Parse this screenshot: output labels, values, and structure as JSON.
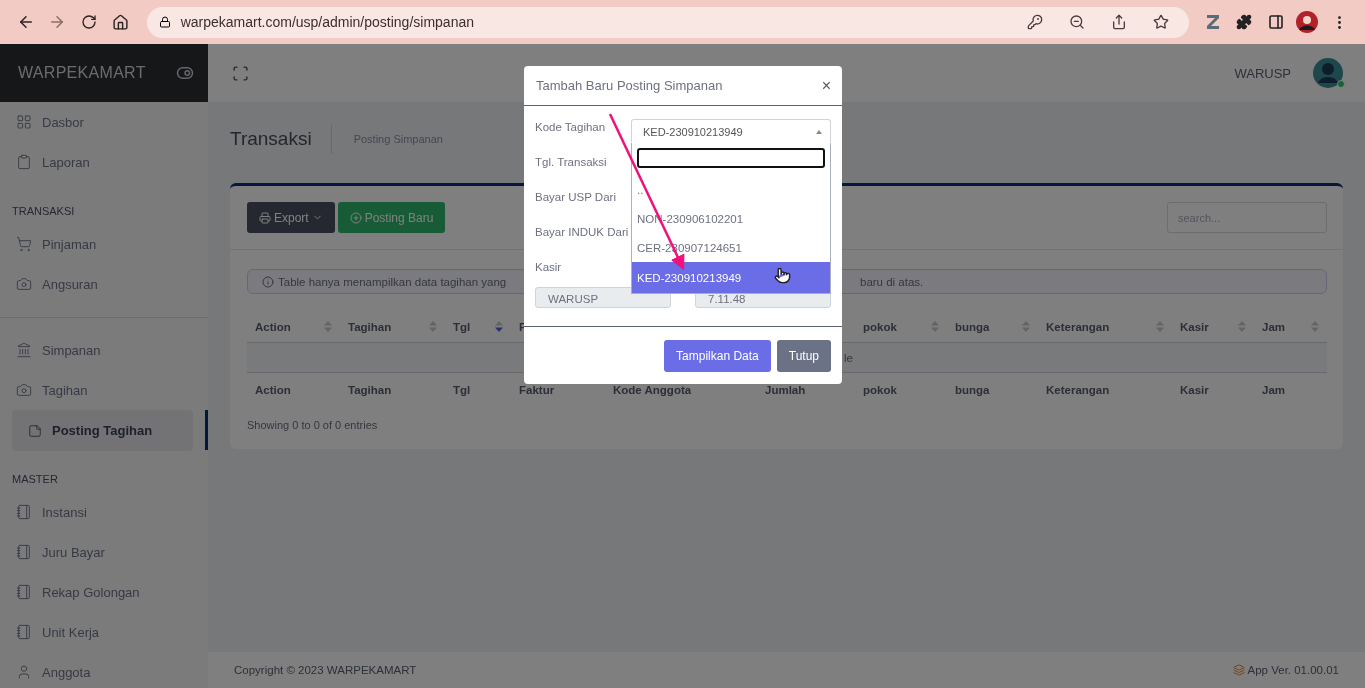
{
  "browser": {
    "url": "warpekamart.com/usp/admin/posting/simpanan"
  },
  "sidebar": {
    "brand": "WARPEKAMART",
    "groups": [
      {
        "items": [
          {
            "label": "Dasbor",
            "selected": false
          },
          {
            "label": "Laporan",
            "selected": false
          }
        ]
      },
      {
        "heading": "TRANSAKSI",
        "items": [
          {
            "label": "Pinjaman",
            "selected": false
          },
          {
            "label": "Angsuran",
            "selected": false
          }
        ]
      },
      {
        "items": [
          {
            "label": "Simpanan",
            "selected": false
          },
          {
            "label": "Tagihan",
            "selected": false,
            "children": [
              {
                "label": "Posting Tagihan",
                "selected": true
              }
            ]
          }
        ]
      },
      {
        "heading": "MASTER",
        "items": [
          {
            "label": "Instansi",
            "selected": false
          },
          {
            "label": "Juru Bayar",
            "selected": false
          },
          {
            "label": "Rekap Golongan",
            "selected": false
          },
          {
            "label": "Unit Kerja",
            "selected": false
          },
          {
            "label": "Anggota",
            "selected": false
          }
        ]
      }
    ]
  },
  "header": {
    "user": "WARUSP"
  },
  "page": {
    "title": "Transaksi",
    "breadcrumb": "Posting Simpanan"
  },
  "toolbar": {
    "export_button": "Export",
    "new_button": "Posting Baru",
    "search": {
      "placeholder": "search..."
    }
  },
  "alert": {
    "parts": [
      "Table hanya menampilkan data tagihan yang",
      "baru di atas."
    ]
  },
  "table": {
    "header": [
      {
        "label": "Action",
        "sorted": false
      },
      {
        "label": "Tagihan",
        "sorted": false
      },
      {
        "label": "Tgl",
        "sorted": true
      },
      {
        "label": "F"
      },
      {
        "label": "pokok",
        "sorted": false
      },
      {
        "label": "bunga",
        "sorted": false
      },
      {
        "label": "Keterangan",
        "sorted": false
      },
      {
        "label": "Kasir",
        "sorted": false
      },
      {
        "label": "Jam",
        "sorted": false
      }
    ],
    "empty_row": "le",
    "footer": [
      "Action",
      "Tagihan",
      "Tgl",
      "Faktur",
      "Kode Anggota",
      "Jumlah",
      "pokok",
      "bunga",
      "Keterangan",
      "Kasir",
      "Jam"
    ],
    "info": "Showing 0 to 0 of 0 entries"
  },
  "footer": {
    "copyright": "Copyright © 2023 WARPEKAMART",
    "version": "App Ver. 01.00.01"
  },
  "modal": {
    "title": "Tambah Baru Posting Simpanan",
    "close": "×",
    "fields": [
      {
        "label": "Kode Tagihan",
        "value": "KED-230910213949"
      },
      {
        "label": "Tgl. Transaksi"
      },
      {
        "label": "Bayar USP Dari"
      },
      {
        "label": "Bayar INDUK Dari"
      }
    ],
    "dropdown": {
      "options": [
        {
          "label": "..",
          "selected": false
        },
        {
          "label": "NON-230906102201",
          "selected": false
        },
        {
          "label": "CER-230907124651",
          "selected": false
        },
        {
          "label": "KED-230910213949",
          "selected": true
        }
      ]
    },
    "kasir": {
      "label": "Kasir",
      "value": "WARUSP"
    },
    "time_value": "7.11.48",
    "buttons": [
      {
        "label": "Tampilkan Data",
        "kind": "primary"
      },
      {
        "label": "Tutup",
        "kind": "secondary"
      }
    ]
  }
}
